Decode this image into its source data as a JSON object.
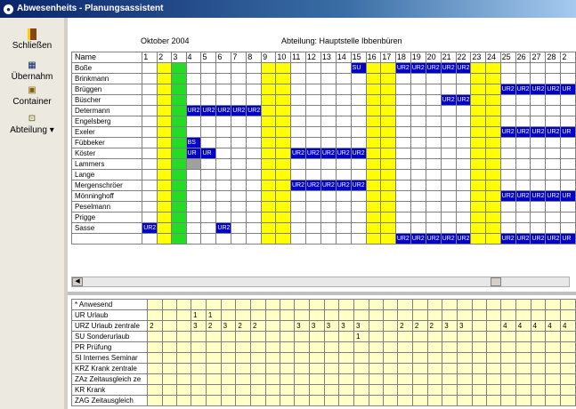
{
  "window": {
    "title": "Abwesenheits - Planungsassistent"
  },
  "toolbar": {
    "close_label": "Schließen",
    "apply_label": "Übernahm",
    "container_label": "Container",
    "department_label": "Abteilung"
  },
  "header": {
    "month": "Oktober 2004",
    "department": "Abteilung:  Hauptstelle Ibbenbüren",
    "name_col": "Name"
  },
  "days": [
    "1",
    "2",
    "3",
    "4",
    "5",
    "6",
    "7",
    "8",
    "9",
    "10",
    "11",
    "12",
    "13",
    "14",
    "15",
    "16",
    "17",
    "18",
    "19",
    "20",
    "21",
    "22",
    "23",
    "24",
    "25",
    "26",
    "27",
    "28",
    "2"
  ],
  "colors": {
    "weekend": "#ffff00",
    "holiday": "#22dd22",
    "absence": "#0000c8",
    "summary_bg": "#ffffc8"
  },
  "employees": [
    {
      "name": "Boße",
      "entries": {
        "15": "SU",
        "18": "UR2",
        "19": "UR2",
        "20": "UR2",
        "21": "UR2",
        "22": "UR2"
      }
    },
    {
      "name": "Brinkmann",
      "entries": {}
    },
    {
      "name": "Brüggen",
      "entries": {
        "25": "UR2",
        "26": "UR2",
        "27": "UR2",
        "28": "UR2",
        "29": "UR"
      }
    },
    {
      "name": "Büscher",
      "entries": {
        "21": "UR2",
        "22": "UR2"
      }
    },
    {
      "name": "Determann",
      "entries": {
        "4": "UR2",
        "5": "UR2",
        "6": "UR2",
        "7": "UR2",
        "8": "UR2"
      }
    },
    {
      "name": "Engelsberg",
      "entries": {}
    },
    {
      "name": "Exeler",
      "entries": {
        "25": "UR2",
        "26": "UR2",
        "27": "UR2",
        "28": "UR2",
        "29": "UR"
      }
    },
    {
      "name": "Fübbeker",
      "entries": {
        "4": "BS"
      }
    },
    {
      "name": "Köster",
      "entries": {
        "4": "UR",
        "5": "UR",
        "11": "UR2",
        "12": "UR2",
        "13": "UR2",
        "14": "UR2",
        "15": "UR2"
      }
    },
    {
      "name": "Lammers",
      "entries": {
        "4": "#gray"
      }
    },
    {
      "name": "Lange",
      "entries": {}
    },
    {
      "name": "Mergenschröer",
      "entries": {
        "11": "UR2",
        "12": "UR2",
        "13": "UR2",
        "14": "UR2",
        "15": "UR2"
      }
    },
    {
      "name": "Mönninghoff",
      "entries": {
        "25": "UR2",
        "26": "UR2",
        "27": "UR2",
        "28": "UR2",
        "29": "UR"
      }
    },
    {
      "name": "Peselmann",
      "entries": {}
    },
    {
      "name": "Prigge",
      "entries": {}
    },
    {
      "name": "Sasse",
      "entries": {
        "1": "UR2",
        "6": "UR2"
      }
    },
    {
      "name": "",
      "entries": {
        "18": "UR2",
        "19": "UR2",
        "20": "UR2",
        "21": "UR2",
        "22": "UR2",
        "25": "UR2",
        "26": "UR2",
        "27": "UR2",
        "28": "UR2",
        "29": "UR"
      }
    }
  ],
  "summary": [
    {
      "name": "* Anwesend",
      "values": {}
    },
    {
      "name": "UR Urlaub",
      "values": {
        "4": "1",
        "5": "1"
      }
    },
    {
      "name": "URZ Urlaub zentrale",
      "values": {
        "1": "2",
        "4": "3",
        "5": "2",
        "6": "3",
        "7": "2",
        "8": "2",
        "11": "3",
        "12": "3",
        "13": "3",
        "14": "3",
        "15": "3",
        "18": "2",
        "19": "2",
        "20": "2",
        "21": "3",
        "22": "3",
        "25": "4",
        "26": "4",
        "27": "4",
        "28": "4",
        "29": "4"
      }
    },
    {
      "name": "SU Sonderurlaub",
      "values": {
        "15": "1"
      }
    },
    {
      "name": "PR Prüfung",
      "values": {}
    },
    {
      "name": "SI Internes Seminar",
      "values": {}
    },
    {
      "name": "KRZ Krank zentrale",
      "values": {}
    },
    {
      "name": "ZAz Zeitausgleich ze",
      "values": {}
    },
    {
      "name": "KR Krank",
      "values": {}
    },
    {
      "name": "ZAG Zeitausgleich",
      "values": {}
    }
  ]
}
